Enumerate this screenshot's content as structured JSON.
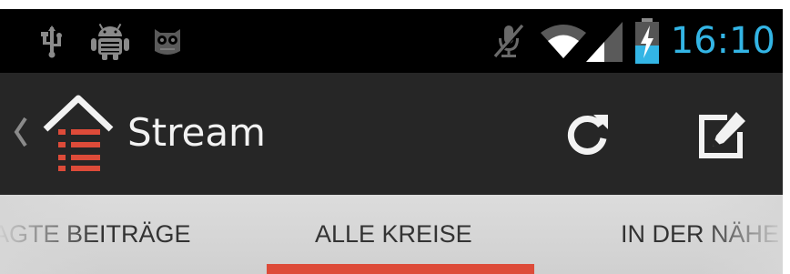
{
  "status_bar": {
    "time": "16:10",
    "icons": [
      "usb-icon",
      "android-debug-icon",
      "owl-icon",
      "mute-icon",
      "wifi-icon",
      "signal-icon",
      "battery-charging-icon"
    ],
    "time_color": "#33b5e5"
  },
  "action_bar": {
    "title": "Stream",
    "app_icon": "home-stream-icon",
    "actions": [
      "refresh-icon",
      "compose-icon"
    ]
  },
  "tabs": {
    "items": [
      {
        "label": "AGTE BEITRÄGE"
      },
      {
        "label": "ALLE KREISE",
        "selected": true
      },
      {
        "label": "IN DER NÄHE"
      }
    ],
    "indicator_color": "#dd4b39"
  }
}
